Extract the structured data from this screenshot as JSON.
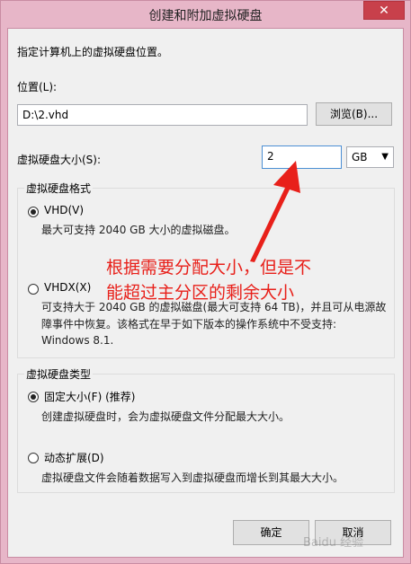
{
  "window": {
    "title": "创建和附加虚拟硬盘",
    "close_label": "✕"
  },
  "intro_text": "指定计算机上的虚拟硬盘位置。",
  "location": {
    "label": "位置(L):",
    "value": "D:\\2.vhd",
    "browse_label": "浏览(B)..."
  },
  "size": {
    "label": "虚拟硬盘大小(S):",
    "value": "2",
    "unit": "GB"
  },
  "format_group": {
    "legend": "虚拟硬盘格式",
    "vhd_label": "VHD(V)",
    "vhd_desc": "最大可支持 2040 GB 大小的虚拟磁盘。",
    "vhdx_label": "VHDX(X)",
    "vhdx_desc_1": "可支持大于 2040 GB 的虚拟磁盘(最大可支持 64 TB)，并且可从电源故",
    "vhdx_desc_2": "障事件中恢复。该格式在早于如下版本的操作系统中不受支持:",
    "vhdx_desc_3": "Windows 8.1."
  },
  "type_group": {
    "legend": "虚拟硬盘类型",
    "fixed_label": "固定大小(F) (推荐)",
    "fixed_desc": "创建虚拟硬盘时，会为虚拟硬盘文件分配最大大小。",
    "dynamic_label": "动态扩展(D)",
    "dynamic_desc": "虚拟硬盘文件会随着数据写入到虚拟硬盘而增长到其最大大小。"
  },
  "annotation": {
    "line1": "根据需要分配大小，但是不",
    "line2": "能超过主分区的剩余大小"
  },
  "buttons": {
    "ok_label": "确定",
    "cancel_label": "取消"
  },
  "watermark": "Baidu 经验",
  "colors": {
    "annotation": "#e8201a",
    "window_frame": "#e7b6c8",
    "close_button": "#c8404b"
  }
}
